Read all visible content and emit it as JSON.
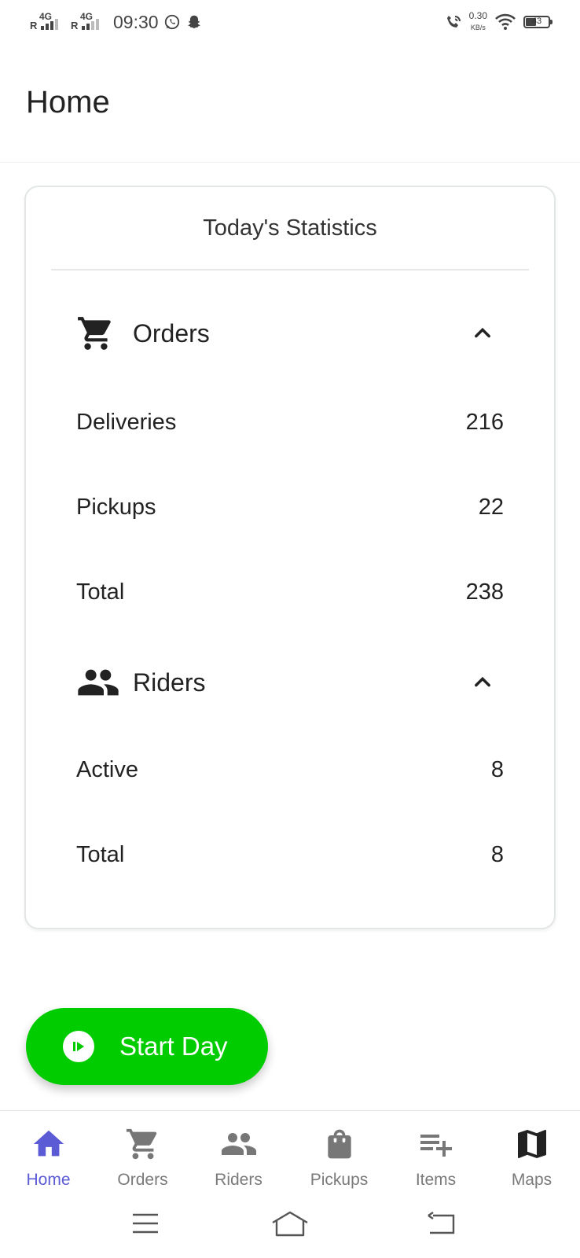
{
  "status_bar": {
    "time": "09:30",
    "sim1_label": "R",
    "sim1_network": "4G",
    "sim2_label": "R",
    "sim2_network": "4G",
    "speed_value": "0.30",
    "speed_unit": "KB/s",
    "battery_level": "43",
    "icons": [
      "whatsapp-icon",
      "snapchat-icon",
      "wifi-calling-icon",
      "wifi-icon",
      "battery-icon"
    ]
  },
  "header": {
    "title": "Home"
  },
  "statistics": {
    "title": "Today's Statistics",
    "orders": {
      "label": "Orders",
      "icon": "cart-icon",
      "rows": [
        {
          "label": "Deliveries",
          "value": "216"
        },
        {
          "label": "Pickups",
          "value": "22"
        },
        {
          "label": "Total",
          "value": "238"
        }
      ]
    },
    "riders": {
      "label": "Riders",
      "icon": "people-icon",
      "rows": [
        {
          "label": "Active",
          "value": "8"
        },
        {
          "label": "Total",
          "value": "8"
        }
      ]
    }
  },
  "fab": {
    "label": "Start Day",
    "icon": "play-circle-icon",
    "color": "#00cc00"
  },
  "bottom_nav": {
    "active": "Home",
    "active_color": "#5b5bd6",
    "items": [
      {
        "label": "Home",
        "icon": "home-icon"
      },
      {
        "label": "Orders",
        "icon": "cart-icon"
      },
      {
        "label": "Riders",
        "icon": "people-icon"
      },
      {
        "label": "Pickups",
        "icon": "shopping-bag-icon"
      },
      {
        "label": "Items",
        "icon": "playlist-add-icon"
      },
      {
        "label": "Maps",
        "icon": "map-icon"
      }
    ]
  },
  "system_nav": {
    "icons": [
      "menu-icon",
      "home-outline-icon",
      "back-icon"
    ]
  }
}
